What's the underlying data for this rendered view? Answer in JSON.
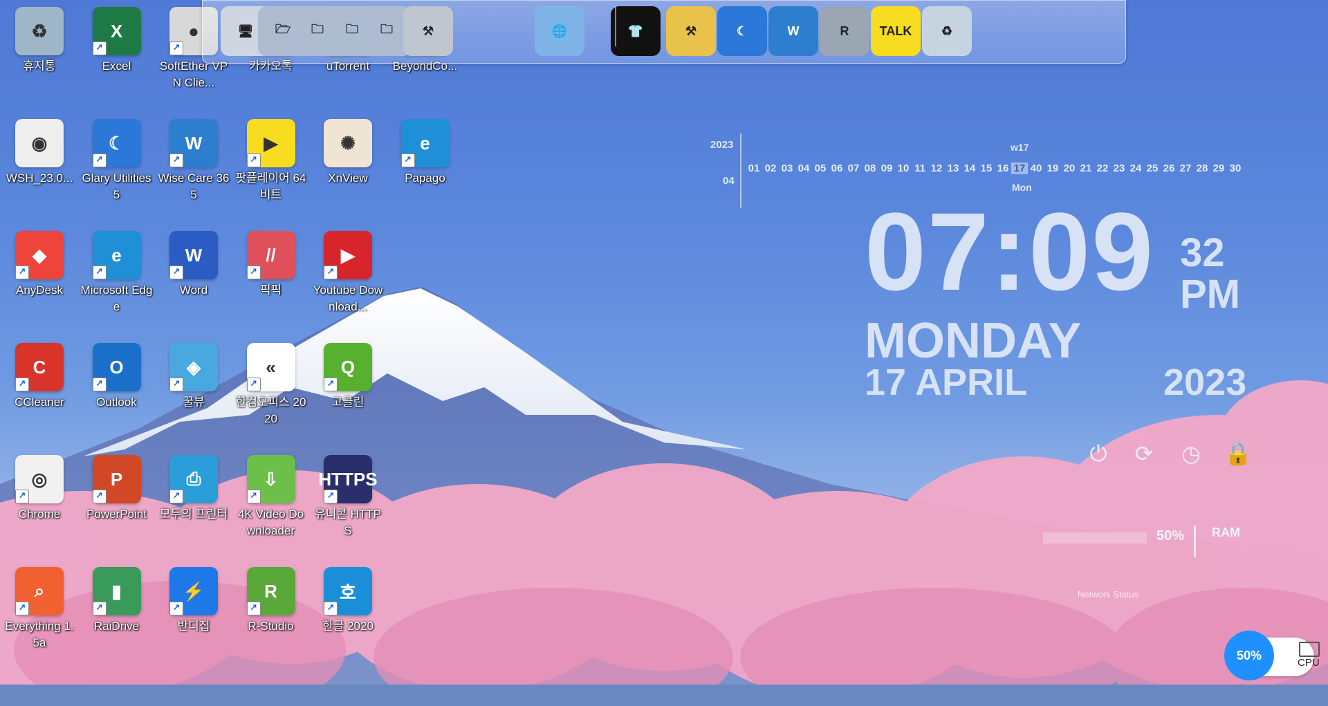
{
  "desktop": {
    "icons": [
      {
        "label": "휴지통",
        "icon": "recycle-bin-icon",
        "color": "#9fb5c8",
        "glyph": "♻",
        "shortcut": false
      },
      {
        "label": "Excel",
        "icon": "excel-icon",
        "color": "#1d7a45",
        "glyph": "X",
        "shortcut": true
      },
      {
        "label": "SoftEther VPN Clie...",
        "icon": "softether-vpn-icon",
        "color": "#d8d8d8",
        "glyph": "●",
        "shortcut": true
      },
      {
        "label": "카카오톡",
        "icon": "kakaotalk-icon",
        "color": "#f5d800",
        "glyph": "TALK",
        "shortcut": true
      },
      {
        "label": "uTorrent",
        "icon": "utorrent-icon",
        "color": "#76b83a",
        "glyph": "µ",
        "shortcut": true
      },
      {
        "label": "BeyondCo...",
        "icon": "beyond-compare-icon",
        "color": "#c83a2a",
        "glyph": "BC",
        "shortcut": true
      },
      {
        "label": "WSH_23.0...",
        "icon": "file-icon",
        "color": "#eeeeee",
        "glyph": "◉",
        "shortcut": false
      },
      {
        "label": "Glary Utilities 5",
        "icon": "glary-utilities-icon",
        "color": "#2b78d8",
        "glyph": "☾",
        "shortcut": true
      },
      {
        "label": "Wise Care 365",
        "icon": "wise-care-icon",
        "color": "#2e7ed0",
        "glyph": "W",
        "shortcut": true
      },
      {
        "label": "팟플레이어 64 비트",
        "icon": "potplayer-icon",
        "color": "#f7dc1f",
        "glyph": "▶",
        "shortcut": true
      },
      {
        "label": "XnView",
        "icon": "xnview-icon",
        "color": "#f0e4d4",
        "glyph": "✺",
        "shortcut": false
      },
      {
        "label": "Papago",
        "icon": "edge-icon",
        "color": "#1f8fd8",
        "glyph": "e",
        "shortcut": true
      },
      {
        "label": "AnyDesk",
        "icon": "anydesk-icon",
        "color": "#ef443b",
        "glyph": "◆",
        "shortcut": true
      },
      {
        "label": "Microsoft Edge",
        "icon": "edge-icon",
        "color": "#1f8fd8",
        "glyph": "e",
        "shortcut": true
      },
      {
        "label": "Word",
        "icon": "word-icon",
        "color": "#2b5cc4",
        "glyph": "W",
        "shortcut": true
      },
      {
        "label": "픽픽",
        "icon": "picpick-icon",
        "color": "#e0505a",
        "glyph": "//",
        "shortcut": true
      },
      {
        "label": "Youtube Download...",
        "icon": "youtube-downloader-icon",
        "color": "#d8252c",
        "glyph": "▶",
        "shortcut": true
      },
      {
        "label": "CCleaner",
        "icon": "ccleaner-icon",
        "color": "#d8342a",
        "glyph": "C",
        "shortcut": true
      },
      {
        "label": "Outlook",
        "icon": "outlook-icon",
        "color": "#1a6fc8",
        "glyph": "O",
        "shortcut": true
      },
      {
        "label": "꿀뷰",
        "icon": "honeyview-icon",
        "color": "#4aa8e0",
        "glyph": "◈",
        "shortcut": true
      },
      {
        "label": "한컴오피스 2020",
        "icon": "hancom-office-icon",
        "color": "#ffffff",
        "glyph": "«",
        "shortcut": true
      },
      {
        "label": "고클린",
        "icon": "goclean-icon",
        "color": "#58b030",
        "glyph": "Q",
        "shortcut": true
      },
      {
        "label": "Chrome",
        "icon": "chrome-icon",
        "color": "#f1f1f1",
        "glyph": "◎",
        "shortcut": true
      },
      {
        "label": "PowerPoint",
        "icon": "powerpoint-icon",
        "color": "#d24726",
        "glyph": "P",
        "shortcut": true
      },
      {
        "label": "모두의 프린터",
        "icon": "printer-icon",
        "color": "#2a9ed8",
        "glyph": "⎙",
        "shortcut": true
      },
      {
        "label": "4K Video Downloader",
        "icon": "4k-video-downloader-icon",
        "color": "#6cc04a",
        "glyph": "⇩",
        "shortcut": true
      },
      {
        "label": "유니콘 HTTPS",
        "icon": "unicorn-https-icon",
        "color": "#2a2e6a",
        "glyph": "HTTPS",
        "shortcut": true
      },
      {
        "label": "Everything 1.5a",
        "icon": "everything-search-icon",
        "color": "#f06030",
        "glyph": "⌕",
        "shortcut": true
      },
      {
        "label": "RaiDrive",
        "icon": "raidrive-icon",
        "color": "#3a9a5a",
        "glyph": "▮",
        "shortcut": true
      },
      {
        "label": "반디집",
        "icon": "bandizip-icon",
        "color": "#1e78e8",
        "glyph": "⚡",
        "shortcut": true
      },
      {
        "label": "R-Studio",
        "icon": "r-studio-icon",
        "color": "#5aa83a",
        "glyph": "R",
        "shortcut": true
      },
      {
        "label": "한글 2020",
        "icon": "hangul-icon",
        "color": "#1a8fd8",
        "glyph": "호",
        "shortcut": true
      }
    ]
  },
  "dock": {
    "items": [
      {
        "icon": "monitor-icon",
        "glyph": "🖥",
        "color": "#cfd6e2"
      },
      {
        "icon": "folder-globe-icon",
        "glyph": "🗁",
        "color": "#aebcd2"
      },
      {
        "icon": "folder-icon",
        "glyph": "🗀",
        "color": "#aebcd2"
      },
      {
        "icon": "folder-icon",
        "glyph": "🗀",
        "color": "#aebcd2"
      },
      {
        "icon": "folder-icon",
        "glyph": "🗀",
        "color": "#aebcd2"
      },
      {
        "icon": "tools-icon",
        "glyph": "⚒",
        "color": "#bfc6cf"
      },
      {
        "icon": "globe-icon",
        "glyph": "🌐",
        "color": "#7fb4e8"
      },
      {
        "icon": "tshirt-icon",
        "glyph": "👕",
        "color": "#111111"
      },
      {
        "icon": "hammer-icon",
        "glyph": "⚒",
        "color": "#e8c24a"
      },
      {
        "icon": "glary-utilities-icon",
        "glyph": "☾",
        "color": "#2b78d8"
      },
      {
        "icon": "wise-care-icon",
        "glyph": "W",
        "color": "#2e7ed0"
      },
      {
        "icon": "r-studio-icon",
        "glyph": "R",
        "color": "#9aa6b4"
      },
      {
        "icon": "kakaotalk-icon",
        "glyph": "TALK",
        "color": "#f7dc1f"
      },
      {
        "icon": "recycle-bin-icon",
        "glyph": "♻",
        "color": "#c6d4e2"
      }
    ]
  },
  "calendar": {
    "year": "2023",
    "month": "04",
    "week_label": "w17",
    "days": [
      "01",
      "02",
      "03",
      "04",
      "05",
      "06",
      "07",
      "08",
      "09",
      "10",
      "11",
      "12",
      "13",
      "14",
      "15",
      "16",
      "17",
      "40",
      "19",
      "20",
      "21",
      "22",
      "23",
      "24",
      "25",
      "26",
      "27",
      "28",
      "29",
      "30"
    ],
    "today": "17",
    "today_dow": "Mon"
  },
  "clock": {
    "hours_minutes": "07:09",
    "seconds": "32",
    "ampm": "PM",
    "day": "MONDAY",
    "date": "17 APRIL",
    "year": "2023"
  },
  "power": {
    "shutdown_icon": "power-icon",
    "restart_icon": "restart-icon",
    "sleep_icon": "sleep-icon",
    "lock_icon": "lock-icon"
  },
  "system": {
    "ram_percent": "50%",
    "ram_label": "RAM",
    "network_label": "Network Status",
    "cpu_percent": "50%",
    "cpu_label": "CPU"
  }
}
